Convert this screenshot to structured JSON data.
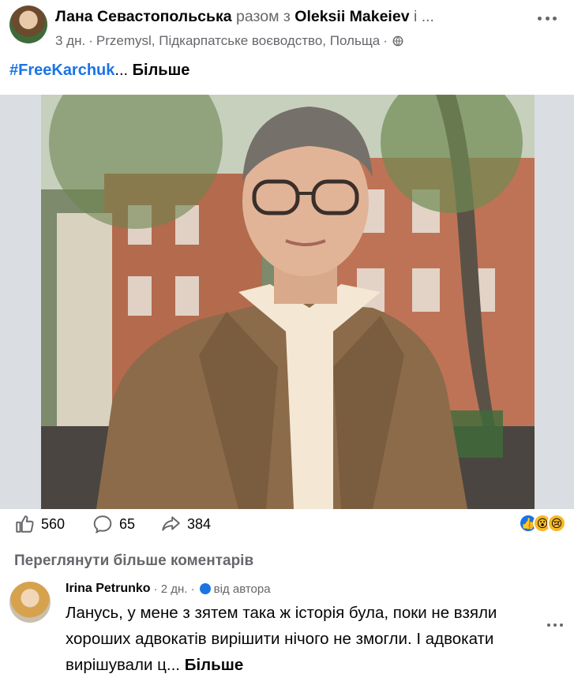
{
  "post": {
    "author": "Лана Севастопольська",
    "with_word": "разом з",
    "tagged": "Oleksii Makeiev",
    "tagged_more": "і ...",
    "time": "3 дн.",
    "separator": "·",
    "location": "Przemysl, Підкарпатське воєводство, Польща",
    "hashtag": "#FreeKarchuk",
    "ellipsis": "...",
    "see_more": "Більше"
  },
  "stats": {
    "likes": "560",
    "comments": "65",
    "shares": "384",
    "reactions": [
      "like-icon",
      "wow-icon",
      "sad-icon"
    ]
  },
  "comments": {
    "view_more": "Переглянути більше коментарів",
    "items": [
      {
        "name": "Irina Petrunko",
        "time": "· 2 дн. ·",
        "by_author": "від автора",
        "text": "Ланусь, у мене з зятем така ж історія була, поки не взяли хороших адвокатів вирішити нічого не змогли. І адвокати вирішували ц...",
        "see_more": "Більше"
      }
    ]
  },
  "colors": {
    "accent": "#1b74e4",
    "secondary_text": "#65676b",
    "primary_text": "#050505"
  }
}
